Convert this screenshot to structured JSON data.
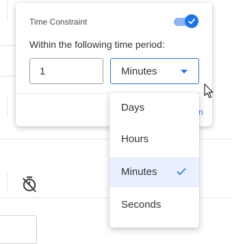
{
  "popover": {
    "title": "Time Constraint",
    "toggle_on": true,
    "label": "Within the following time period:",
    "number_value": "1",
    "unit_selected": "Minutes",
    "partial_link": "n"
  },
  "dropdown": {
    "options": [
      {
        "label": "Days",
        "selected": false
      },
      {
        "label": "Hours",
        "selected": false
      },
      {
        "label": "Minutes",
        "selected": true
      },
      {
        "label": "Seconds",
        "selected": false
      }
    ]
  },
  "colors": {
    "accent": "#1a73e8",
    "track": "#8ab4f8",
    "selected_bg": "#e8f0fe"
  },
  "icons": [
    "check-icon",
    "caret-down-icon",
    "timer-off-icon",
    "mouse-cursor-icon"
  ]
}
